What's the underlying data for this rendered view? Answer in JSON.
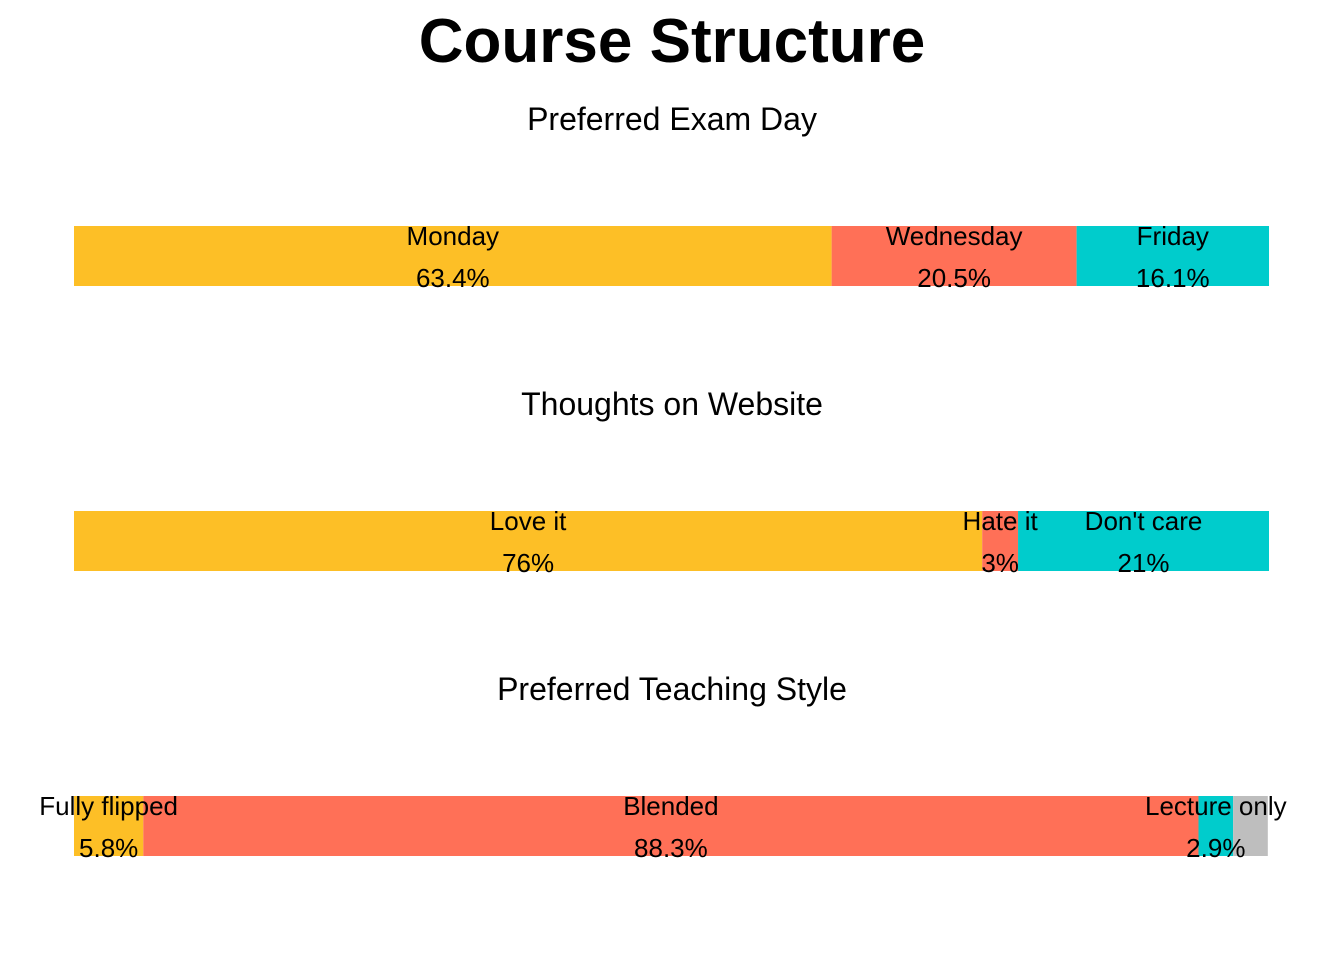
{
  "title": "Course Structure",
  "chart_data": [
    {
      "type": "bar",
      "orientation": "horizontal",
      "stacked": true,
      "title": "Preferred Exam Day",
      "xlabel": "",
      "ylabel": "",
      "xlim": [
        0,
        100
      ],
      "grid": false,
      "segments": [
        {
          "category": "Monday",
          "value": 63.4,
          "label": "63.4%",
          "color": "#FDBF26"
        },
        {
          "category": "Wednesday",
          "value": 20.5,
          "label": "20.5%",
          "color": "#FF7057"
        },
        {
          "category": "Friday",
          "value": 16.1,
          "label": "16.1%",
          "color": "#00CCCC"
        }
      ]
    },
    {
      "type": "bar",
      "orientation": "horizontal",
      "stacked": true,
      "title": "Thoughts on Website",
      "xlabel": "",
      "ylabel": "",
      "xlim": [
        0,
        100
      ],
      "grid": false,
      "segments": [
        {
          "category": "Love it",
          "value": 76,
          "label": "76%",
          "color": "#FDBF26"
        },
        {
          "category": "Hate it",
          "value": 3,
          "label": "3%",
          "color": "#FF7057"
        },
        {
          "category": "Don't care",
          "value": 21,
          "label": "21%",
          "color": "#00CCCC"
        }
      ]
    },
    {
      "type": "bar",
      "orientation": "horizontal",
      "stacked": true,
      "title": "Preferred Teaching Style",
      "xlabel": "",
      "ylabel": "",
      "xlim": [
        0,
        100
      ],
      "grid": false,
      "segments": [
        {
          "category": "Fully flipped",
          "value": 5.8,
          "label": "5.8%",
          "color": "#FDBF26"
        },
        {
          "category": "Blended",
          "value": 88.3,
          "label": "88.3%",
          "color": "#FF7057"
        },
        {
          "category": "Lecture only",
          "value": 2.9,
          "label": "2.9%",
          "color": "#00CCCC"
        },
        {
          "category": "",
          "value": 2.9,
          "label": "",
          "color": "#BEBEBE"
        }
      ]
    }
  ]
}
